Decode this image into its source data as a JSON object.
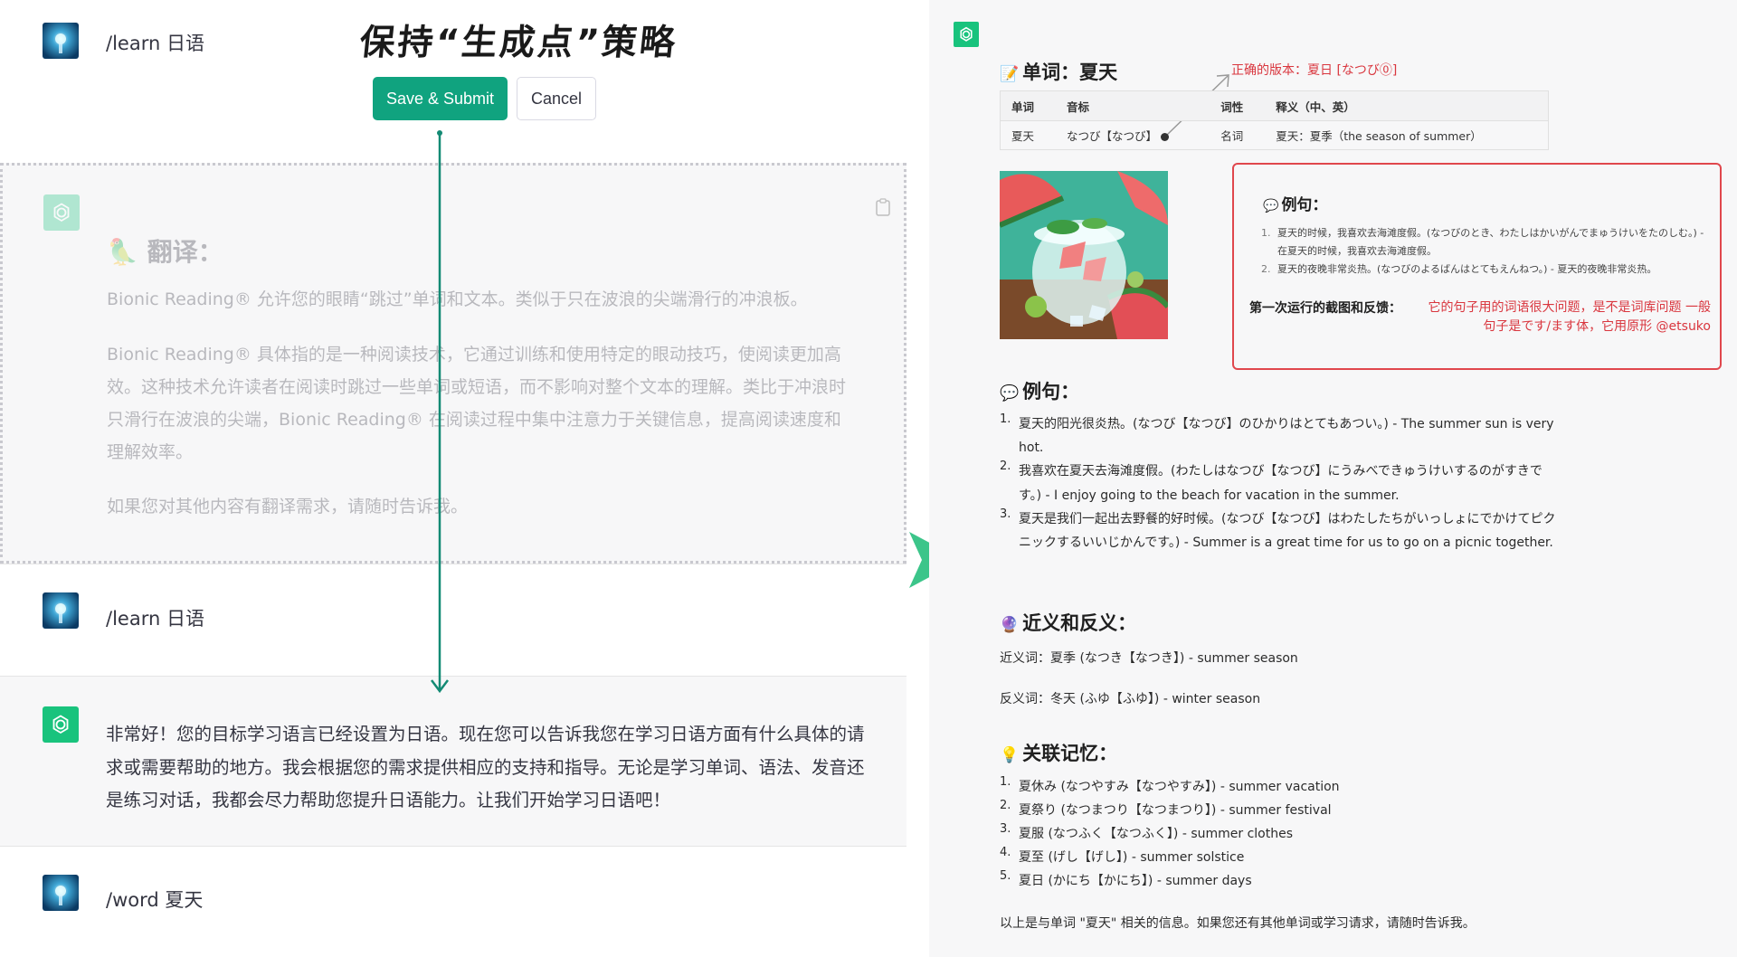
{
  "left": {
    "headline": "保持“生成点”策略",
    "edit_row": {
      "command": "/learn 日语",
      "save_label": "Save & Submit",
      "cancel_label": "Cancel"
    },
    "faded_message": {
      "title": "🦜 翻译：",
      "p1": "Bionic Reading® 允许您的眼睛“跳过”单词和文本。类似于只在波浪的尖端滑行的冲浪板。",
      "p2": "Bionic Reading® 具体指的是一种阅读技术，它通过训练和使用特定的眼动技巧，使阅读更加高效。这种技术允许读者在阅读时跳过一些单词或短语，而不影响对整个文本的理解。类比于冲浪时只滑行在波浪的尖端，Bionic Reading® 在阅读过程中集中注意力于关键信息，提高阅读速度和理解效率。",
      "p3": "如果您对其他内容有翻译需求，请随时告诉我。"
    },
    "learn_row": {
      "command": "/learn 日语"
    },
    "reply": {
      "text": "非常好！您的目标学习语言已经设置为日语。现在您可以告诉我您在学习日语方面有什么具体的请求或需要帮助的地方。我会根据您的需求提供相应的支持和指导。无论是学习单词、语法、发音还是练习对话，我都会尽力帮助您提升日语能力。让我们开始学习日语吧！"
    },
    "word_row": {
      "command": "/word 夏天"
    }
  },
  "right": {
    "word_heading": "单词：夏天",
    "word_heading_emoji": "📝",
    "correct_note": "正确的版本：夏日 [なつび⓪]",
    "table": {
      "headers": [
        "单词",
        "音标",
        "词性",
        "释义（中、英）"
      ],
      "row": [
        "夏天",
        "なつび【なつび】",
        "名词",
        "夏天：夏季（the season of summer）"
      ]
    },
    "feedback": {
      "title": "例句：",
      "items": [
        "夏天的时候，我喜欢去海滩度假。(なつびのとき、わたしはかいがんでまゅうけいをたのしむ。) - 在夏天的时候，我喜欢去海滩度假。",
        "夏天的夜晚非常炎热。(なつびのよるばんはとてもえんねつ。) - 夏天的夜晚非常炎热。"
      ],
      "label": "第一次运行的截图和反馈：",
      "comment": "它的句子用的词语很大问题，是不是词库问题 一般句子是です/ます体，它用原形 @etsuko"
    },
    "examples_heading": "例句：",
    "examples": [
      "夏天的阳光很炎热。(なつび【なつび】のひかりはとてもあつい。) - The summer sun is very hot.",
      "我喜欢在夏天去海滩度假。(わたしはなつび【なつび】にうみべできゅうけいするのがすきです。) - I enjoy going to the beach for vacation in the summer.",
      "夏天是我们一起出去野餐的好时候。(なつび【なつび】はわたしたちがいっしょにでかけてピクニックするいいじかんです。) - Summer is a great time for us to go on a picnic together."
    ],
    "syn_heading": "近义和反义：",
    "synonym": "近义词：夏季 (なつき【なつき】) - summer season",
    "antonym": "反义词：冬天 (ふゆ【ふゆ】) - winter season",
    "related_heading": "关联记忆：",
    "related": [
      "夏休み (なつやすみ【なつやすみ】) - summer vacation",
      "夏祭り (なつまつり【なつまつり】) - summer festival",
      "夏服 (なつふく【なつふく】) - summer clothes",
      "夏至 (げし【げし】) - summer solstice",
      "夏日 (かにち【かにち】) - summer days"
    ],
    "footer": "以上是与单词 \"夏天\" 相关的信息。如果您还有其他单词或学习请求，请随时告诉我。"
  },
  "colors": {
    "accent": "#10a37f",
    "highlight": "#d9363e",
    "arrow": "#3cc58a"
  }
}
